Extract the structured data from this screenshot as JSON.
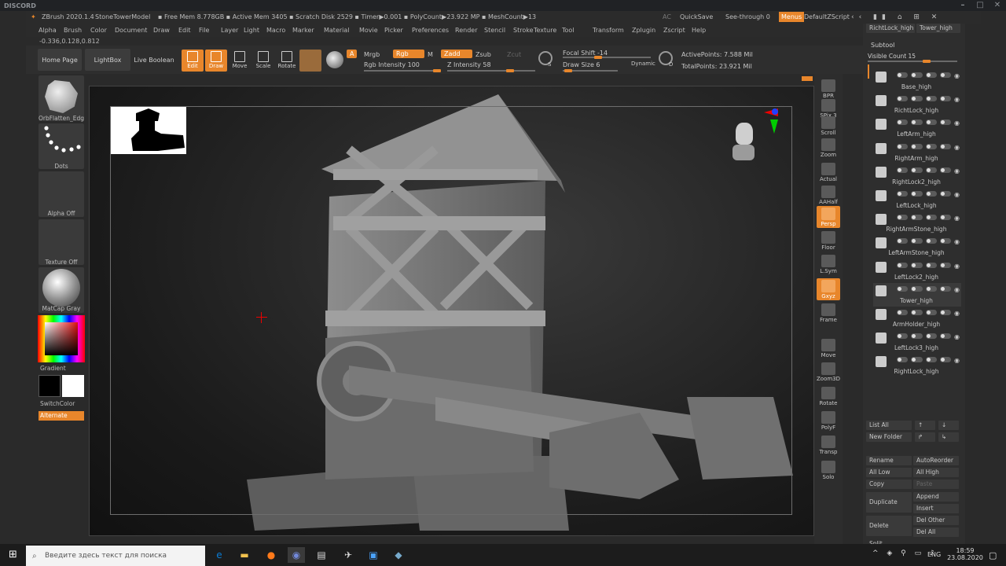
{
  "discord": {
    "label": "DISCORD"
  },
  "title": {
    "app": "ZBrush 2020.1.4",
    "doc": "StoneTowerModel",
    "stats": "▪ Free Mem 8.778GB ▪ Active Mem 3405 ▪ Scratch Disk 2529 ▪ Timer▶0.001 ▪ PolyCount▶23.922 MP ▪ MeshCount▶13",
    "ac": "AC",
    "quicksave": "QuickSave",
    "see_through": "See-through  0",
    "menus": "Menus",
    "script": "DefaultZScript"
  },
  "menu": [
    "Alpha",
    "Brush",
    "Color",
    "Document",
    "Draw",
    "Edit",
    "File",
    "Layer",
    "Light",
    "Macro",
    "Marker",
    "Material",
    "Movie",
    "Picker",
    "Preferences",
    "Render",
    "Stencil",
    "Stroke",
    "Texture",
    "Tool",
    "Transform",
    "Zplugin",
    "Zscript",
    "Help"
  ],
  "coords": "-0.336,0.128,0.812",
  "shelf": {
    "home": "Home Page",
    "lightbox": "LightBox",
    "liveboolean": "Live Boolean",
    "tools": [
      "Edit",
      "Draw",
      "Move",
      "Scale",
      "Rotate"
    ],
    "a": "A",
    "mrgb": "Mrgb",
    "rgb": "Rgb",
    "m": "M",
    "rgb_intensity": "Rgb Intensity 100",
    "zadd": "Zadd",
    "zsub": "Zsub",
    "zcut": "Zcut",
    "z_intensity": "Z Intensity 58",
    "focal_shift": "Focal Shift -14",
    "draw_size": "Draw Size 6",
    "dynamic": "Dynamic",
    "s": "S",
    "d": "D",
    "active_points": "ActivePoints: 7.588 Mil",
    "total_points": "TotalPoints: 23.921 Mil"
  },
  "left": [
    {
      "caption": "OrbFlatten_Edge"
    },
    {
      "caption": "Dots"
    },
    {
      "caption": "Alpha Off"
    },
    {
      "caption": "Texture Off"
    },
    {
      "caption": "MatCap Gray"
    }
  ],
  "gradient": "Gradient",
  "switchcolor": "SwitchColor",
  "alternate": "Alternate",
  "nav": [
    "BPR",
    "SPix 3",
    "Scroll",
    "Zoom",
    "Actual",
    "AAHalf",
    "Persp",
    "Floor",
    "L.Sym",
    "Gxyz",
    "Frame",
    "Move",
    "Zoom3D",
    "Rotate",
    "PolyF",
    "Transp",
    "Solo"
  ],
  "subtool": {
    "top_tabs": [
      "RichtLock_high",
      "Tower_high"
    ],
    "header": "Subtool",
    "visible_count": "Visible Count 15",
    "items": [
      "Base_high",
      "RichtLock_high",
      "LeftArm_high",
      "RightArm_high",
      "RightLock2_high",
      "LeftLock_high",
      "RightArmStone_high",
      "LeftArmStone_high",
      "LeftLock2_high",
      "Tower_high",
      "ArmHolder_high",
      "LeftLock3_high",
      "RightLock_high"
    ]
  },
  "panel_buttons": {
    "list_all": "List All",
    "new_folder": "New Folder",
    "rename": "Rename",
    "autoreorder": "AutoReorder",
    "all_low": "All Low",
    "all_high": "All High",
    "copy": "Copy",
    "paste": "Paste",
    "duplicate": "Duplicate",
    "append": "Append",
    "insert": "Insert",
    "delete": "Delete",
    "del_other": "Del Other",
    "del_all": "Del All",
    "split": "Split"
  },
  "taskbar": {
    "search_placeholder": "Введите здесь текст для поиска",
    "lang": "ENG",
    "time": "18:59",
    "date": "23.08.2020"
  }
}
